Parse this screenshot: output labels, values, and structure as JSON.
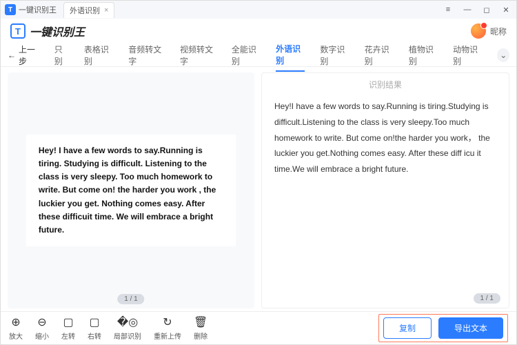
{
  "titlebar": {
    "app": "一键识别王",
    "tab": "外语识别"
  },
  "header": {
    "logo": "一键识别王",
    "nickname": "昵称"
  },
  "tabs": {
    "back": "上一步",
    "items": [
      "只别",
      "表格识别",
      "音频转文字",
      "视频转文字",
      "全能识别",
      "外语识别",
      "数字识别",
      "花卉识别",
      "植物识别",
      "动物识别"
    ],
    "activeIndex": 5
  },
  "left": {
    "image_text": "Hey! I have a few words to say.Running is tiring. Studying is difficult. Listening to the class is very sleepy. Too much homework to write. But come on! the harder you work , the luckier you get. Nothing comes easy. After these difficuit time. We will embrace a bright future.",
    "page": "1 / 1"
  },
  "right": {
    "title": "识别结果",
    "text": "Hey!I have a few words to say.Running is tiring.Studying is difficult.Listening to the class is very sleepy.Too much homework to write. But come on!the harder you work， the luckier you get.Nothing comes easy. After these diff icu it time.We will embrace a bright future.",
    "page": "1 / 1"
  },
  "tools": {
    "zoom_in": "放大",
    "zoom_out": "缩小",
    "rotate_left": "左转",
    "rotate_right": "右转",
    "region": "局部识别",
    "reupload": "重新上传",
    "delete": "删除"
  },
  "actions": {
    "copy": "复制",
    "export": "导出文本"
  }
}
